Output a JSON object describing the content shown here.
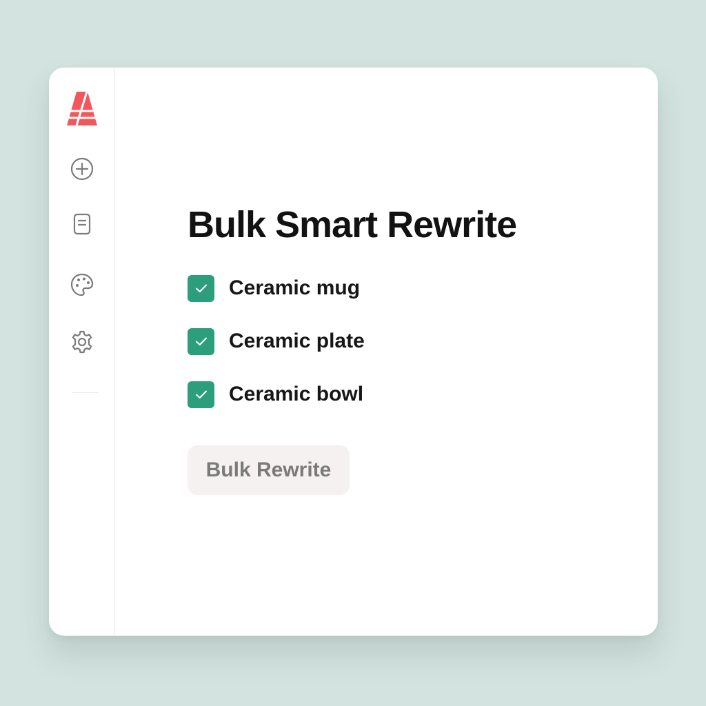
{
  "main": {
    "title": "Bulk Smart Rewrite",
    "items": [
      {
        "label": "Ceramic mug",
        "checked": true
      },
      {
        "label": "Ceramic plate",
        "checked": true
      },
      {
        "label": "Ceramic bowl",
        "checked": true
      }
    ],
    "button_label": "Bulk Rewrite"
  },
  "sidebar": {
    "icons": [
      "app-logo-icon",
      "add-circle-icon",
      "document-icon",
      "palette-icon",
      "settings-gear-icon"
    ]
  },
  "colors": {
    "background": "#d3e3df",
    "brand": "#f2575c",
    "checkbox": "#2c9e7c",
    "button_bg": "#f4f1f0",
    "button_text": "#7a7a7a",
    "icon": "#7b7b7b"
  }
}
